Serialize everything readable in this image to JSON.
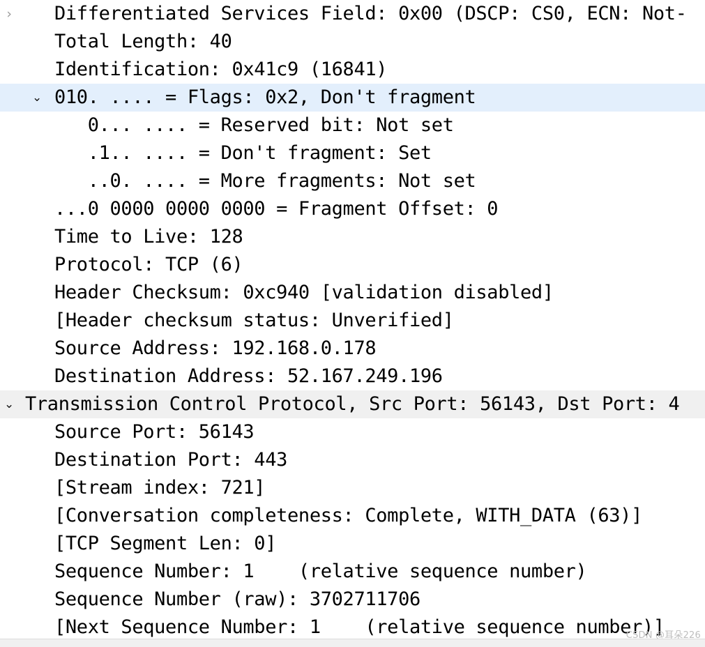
{
  "pane": {
    "name": "packet-details",
    "background": "#ffffff",
    "selected_row_color": "#e3effc",
    "active_row_color": "#f0f0f0",
    "text_color": "#000000"
  },
  "icons": {
    "collapsed": "›",
    "expanded": "⌄"
  },
  "rows": [
    {
      "id": "dsfield",
      "text": "Differentiated Services Field: 0x00 (DSCP: CS0, ECN: Not-",
      "twisty": "collapsed",
      "twisty_depth": 0,
      "indent": 1,
      "highlight": "none"
    },
    {
      "id": "total-length",
      "text": "Total Length: 40",
      "twisty": "none",
      "indent": 1,
      "highlight": "none"
    },
    {
      "id": "identification",
      "text": "Identification: 0x41c9 (16841)",
      "twisty": "none",
      "indent": 1,
      "highlight": "none"
    },
    {
      "id": "flags",
      "text": "010. .... = Flags: 0x2, Don't fragment",
      "twisty": "expanded",
      "twisty_depth": 1,
      "indent": 1,
      "highlight": "blue"
    },
    {
      "id": "reserved-bit",
      "text": "   0... .... = Reserved bit: Not set",
      "twisty": "none",
      "indent": 1,
      "highlight": "none"
    },
    {
      "id": "dont-fragment",
      "text": "   .1.. .... = Don't fragment: Set",
      "twisty": "none",
      "indent": 1,
      "highlight": "none"
    },
    {
      "id": "more-fragments",
      "text": "   ..0. .... = More fragments: Not set",
      "twisty": "none",
      "indent": 1,
      "highlight": "none"
    },
    {
      "id": "fragment-offset",
      "text": "...0 0000 0000 0000 = Fragment Offset: 0",
      "twisty": "none",
      "indent": 1,
      "highlight": "none"
    },
    {
      "id": "time-to-live",
      "text": "Time to Live: 128",
      "twisty": "none",
      "indent": 1,
      "highlight": "none"
    },
    {
      "id": "protocol",
      "text": "Protocol: TCP (6)",
      "twisty": "none",
      "indent": 1,
      "highlight": "none"
    },
    {
      "id": "header-checksum",
      "text": "Header Checksum: 0xc940 [validation disabled]",
      "twisty": "none",
      "indent": 1,
      "highlight": "none"
    },
    {
      "id": "header-checksum-status",
      "text": "[Header checksum status: Unverified]",
      "twisty": "none",
      "indent": 1,
      "highlight": "none"
    },
    {
      "id": "source-address",
      "text": "Source Address: 192.168.0.178",
      "twisty": "none",
      "indent": 1,
      "highlight": "none"
    },
    {
      "id": "destination-address",
      "text": "Destination Address: 52.167.249.196",
      "twisty": "none",
      "indent": 1,
      "highlight": "none"
    },
    {
      "id": "tcp-protocol",
      "text": "Transmission Control Protocol, Src Port: 56143, Dst Port: 4",
      "twisty": "expanded",
      "twisty_depth": 0,
      "indent": 0,
      "highlight": "gray"
    },
    {
      "id": "source-port",
      "text": "Source Port: 56143",
      "twisty": "none",
      "indent": 1,
      "highlight": "none"
    },
    {
      "id": "destination-port",
      "text": "Destination Port: 443",
      "twisty": "none",
      "indent": 1,
      "highlight": "none"
    },
    {
      "id": "stream-index",
      "text": "[Stream index: 721]",
      "twisty": "none",
      "indent": 1,
      "highlight": "none"
    },
    {
      "id": "conversation-completeness",
      "text": "[Conversation completeness: Complete, WITH_DATA (63)]",
      "twisty": "none",
      "indent": 1,
      "highlight": "none"
    },
    {
      "id": "tcp-segment-len",
      "text": "[TCP Segment Len: 0]",
      "twisty": "none",
      "indent": 1,
      "highlight": "none"
    },
    {
      "id": "sequence-number",
      "text": "Sequence Number: 1    (relative sequence number)",
      "twisty": "none",
      "indent": 1,
      "highlight": "none"
    },
    {
      "id": "sequence-number-raw",
      "text": "Sequence Number (raw): 3702711706",
      "twisty": "none",
      "indent": 1,
      "highlight": "none"
    },
    {
      "id": "next-sequence-number",
      "text": "[Next Sequence Number: 1    (relative sequence number)]",
      "twisty": "none",
      "indent": 1,
      "highlight": "none"
    }
  ],
  "watermark": {
    "text": "CSDN @耳朵226",
    "color": "#bdbdbd"
  }
}
